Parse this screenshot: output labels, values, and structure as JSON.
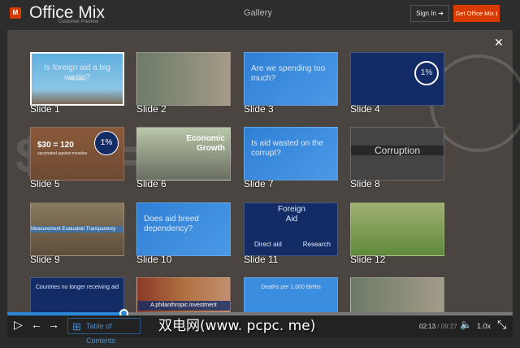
{
  "header": {
    "app_name": "Office Mix",
    "subtitle": "Customer Preview",
    "logo_letter": "M",
    "section": "Gallery",
    "sign_in": "Sign In",
    "get_mix": "Get Office Mix"
  },
  "slides": [
    {
      "label": "Slide 1",
      "text": "Is foreign aid a big waste?",
      "sub": "Bill Gates"
    },
    {
      "label": "Slide 2",
      "text": ""
    },
    {
      "label": "Slide 3",
      "text": "Are we spending too much?"
    },
    {
      "label": "Slide 4",
      "text": "1%"
    },
    {
      "label": "Slide 5",
      "text": "$30 = 120",
      "sub": "vaccinated against measles",
      "badge": "1%"
    },
    {
      "label": "Slide 6",
      "text": "Economic Growth"
    },
    {
      "label": "Slide 7",
      "text": "Is aid wasted on the corrupt?"
    },
    {
      "label": "Slide 8",
      "text": "Corruption"
    },
    {
      "label": "Slide 9",
      "text": "Measurement  Evaluation  Transparency"
    },
    {
      "label": "Slide 10",
      "text": "Does aid breed dependency?"
    },
    {
      "label": "Slide 11",
      "text": "Foreign Aid",
      "left": "Direct aid",
      "right": "Research"
    },
    {
      "label": "Slide 12",
      "text": ""
    },
    {
      "label": "",
      "text": "Countries no longer receiving aid"
    },
    {
      "label": "",
      "text": "A philanthropic investment"
    },
    {
      "label": "",
      "text": "Deaths per 1,000 Births"
    },
    {
      "label": "",
      "text": ""
    }
  ],
  "player": {
    "progress_percent": 23,
    "toc": "Table of Contents",
    "current_time": "02:13",
    "total_time": "09:27",
    "separator": " / ",
    "speed": "1.0x"
  },
  "watermark": "双电网(www. pcpc. me)"
}
